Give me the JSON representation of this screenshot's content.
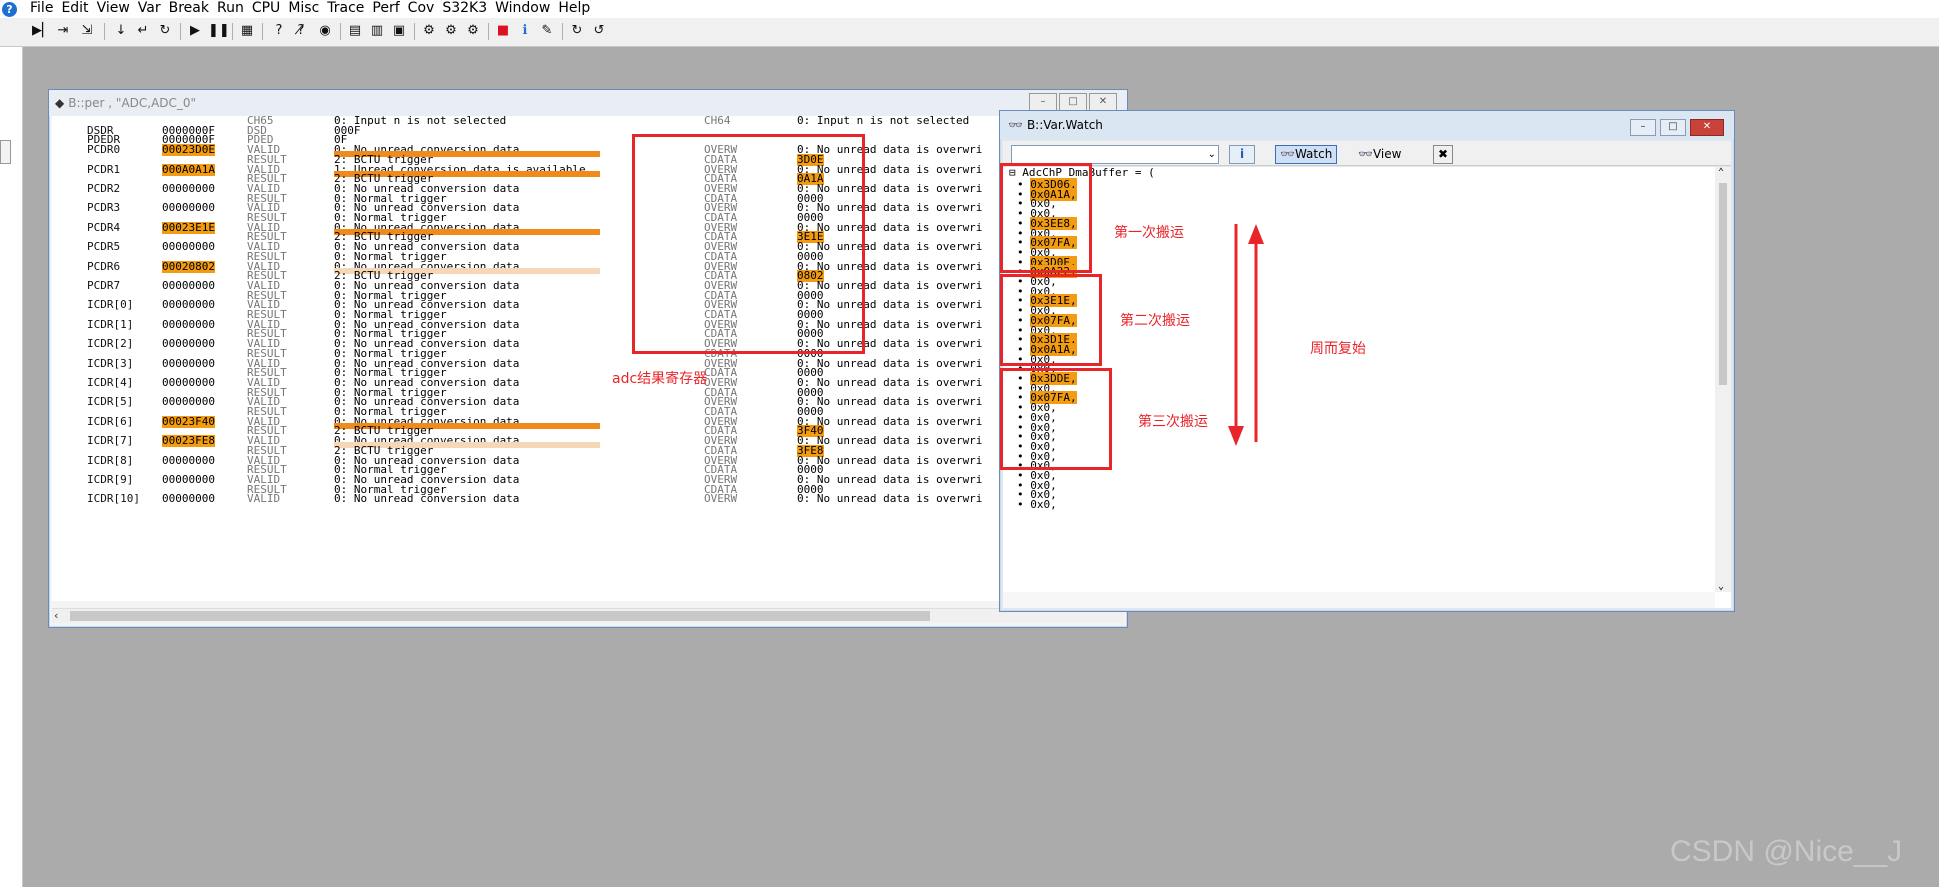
{
  "menubar": {
    "items": [
      "File",
      "Edit",
      "View",
      "Var",
      "Break",
      "Run",
      "CPU",
      "Misc",
      "Trace",
      "Perf",
      "Cov",
      "S32K3",
      "Window",
      "Help"
    ]
  },
  "per_window": {
    "title": "B::per , \"ADC,ADC_0\"",
    "rows": [
      {
        "c1": "",
        "c2": "",
        "c3": "CH65",
        "c4": "0: Input n is not selected",
        "c5": "CH64",
        "c6": "0: Input n is not selected"
      },
      {
        "c1": "DSDR",
        "c2": "0000000F",
        "c3": "DSD",
        "c4": "000F",
        "c5": "",
        "c6": ""
      },
      {
        "c1": "PDEDR",
        "c2": "0000000F",
        "c3": "PDED",
        "c4": "0F",
        "c5": "",
        "c6": ""
      },
      {
        "c1": "PCDR0",
        "c2": "00023D0E",
        "c3": "VALID",
        "c4": "0: No unread conversion data",
        "c5": "OVERW",
        "c6": "0: No unread data is overwri"
      },
      {
        "c1": "",
        "c2": "",
        "c3": "RESULT",
        "c4": "2: BCTU trigger",
        "c5": "CDATA",
        "c6": "3D0E"
      },
      {
        "c1": "PCDR1",
        "c2": "000A0A1A",
        "c3": "VALID",
        "c4": "1: Unread conversion data is available",
        "c5": "OVERW",
        "c6": "0: No unread data is overwri"
      },
      {
        "c1": "",
        "c2": "",
        "c3": "RESULT",
        "c4": "2: BCTU trigger",
        "c5": "CDATA",
        "c6": "0A1A"
      },
      {
        "c1": "PCDR2",
        "c2": "00000000",
        "c3": "VALID",
        "c4": "0: No unread conversion data",
        "c5": "OVERW",
        "c6": "0: No unread data is overwri"
      },
      {
        "c1": "",
        "c2": "",
        "c3": "RESULT",
        "c4": "0: Normal trigger",
        "c5": "CDATA",
        "c6": "0000"
      },
      {
        "c1": "PCDR3",
        "c2": "00000000",
        "c3": "VALID",
        "c4": "0: No unread conversion data",
        "c5": "OVERW",
        "c6": "0: No unread data is overwri"
      },
      {
        "c1": "",
        "c2": "",
        "c3": "RESULT",
        "c4": "0: Normal trigger",
        "c5": "CDATA",
        "c6": "0000"
      },
      {
        "c1": "PCDR4",
        "c2": "00023E1E",
        "c3": "VALID",
        "c4": "0: No unread conversion data",
        "c5": "OVERW",
        "c6": "0: No unread data is overwri"
      },
      {
        "c1": "",
        "c2": "",
        "c3": "RESULT",
        "c4": "2: BCTU trigger",
        "c5": "CDATA",
        "c6": "3E1E"
      },
      {
        "c1": "PCDR5",
        "c2": "00000000",
        "c3": "VALID",
        "c4": "0: No unread conversion data",
        "c5": "OVERW",
        "c6": "0: No unread data is overwri"
      },
      {
        "c1": "",
        "c2": "",
        "c3": "RESULT",
        "c4": "0: Normal trigger",
        "c5": "CDATA",
        "c6": "0000"
      },
      {
        "c1": "PCDR6",
        "c2": "00020802",
        "c3": "VALID",
        "c4": "0: No unread conversion data",
        "c5": "OVERW",
        "c6": "0: No unread data is overwri"
      },
      {
        "c1": "",
        "c2": "",
        "c3": "RESULT",
        "c4": "2: BCTU trigger",
        "c5": "CDATA",
        "c6": "0802"
      },
      {
        "c1": "PCDR7",
        "c2": "00000000",
        "c3": "VALID",
        "c4": "0: No unread conversion data",
        "c5": "OVERW",
        "c6": "0: No unread data is overwri"
      },
      {
        "c1": "",
        "c2": "",
        "c3": "RESULT",
        "c4": "0: Normal trigger",
        "c5": "CDATA",
        "c6": "0000"
      },
      {
        "c1": "ICDR[0]",
        "c2": "00000000",
        "c3": "VALID",
        "c4": "0: No unread conversion data",
        "c5": "OVERW",
        "c6": "0: No unread data is overwri"
      },
      {
        "c1": "",
        "c2": "",
        "c3": "RESULT",
        "c4": "0: Normal trigger",
        "c5": "CDATA",
        "c6": "0000"
      },
      {
        "c1": "ICDR[1]",
        "c2": "00000000",
        "c3": "VALID",
        "c4": "0: No unread conversion data",
        "c5": "OVERW",
        "c6": "0: No unread data is overwri"
      },
      {
        "c1": "",
        "c2": "",
        "c3": "RESULT",
        "c4": "0: Normal trigger",
        "c5": "CDATA",
        "c6": "0000"
      },
      {
        "c1": "ICDR[2]",
        "c2": "00000000",
        "c3": "VALID",
        "c4": "0: No unread conversion data",
        "c5": "OVERW",
        "c6": "0: No unread data is overwri"
      },
      {
        "c1": "",
        "c2": "",
        "c3": "RESULT",
        "c4": "0: Normal trigger",
        "c5": "CDATA",
        "c6": "0000"
      },
      {
        "c1": "ICDR[3]",
        "c2": "00000000",
        "c3": "VALID",
        "c4": "0: No unread conversion data",
        "c5": "OVERW",
        "c6": "0: No unread data is overwri"
      },
      {
        "c1": "",
        "c2": "",
        "c3": "RESULT",
        "c4": "0: Normal trigger",
        "c5": "CDATA",
        "c6": "0000"
      },
      {
        "c1": "ICDR[4]",
        "c2": "00000000",
        "c3": "VALID",
        "c4": "0: No unread conversion data",
        "c5": "OVERW",
        "c6": "0: No unread data is overwri"
      },
      {
        "c1": "",
        "c2": "",
        "c3": "RESULT",
        "c4": "0: Normal trigger",
        "c5": "CDATA",
        "c6": "0000"
      },
      {
        "c1": "ICDR[5]",
        "c2": "00000000",
        "c3": "VALID",
        "c4": "0: No unread conversion data",
        "c5": "OVERW",
        "c6": "0: No unread data is overwri"
      },
      {
        "c1": "",
        "c2": "",
        "c3": "RESULT",
        "c4": "0: Normal trigger",
        "c5": "CDATA",
        "c6": "0000"
      },
      {
        "c1": "ICDR[6]",
        "c2": "00023F40",
        "c3": "VALID",
        "c4": "0: No unread conversion data",
        "c5": "OVERW",
        "c6": "0: No unread data is overwri"
      },
      {
        "c1": "",
        "c2": "",
        "c3": "RESULT",
        "c4": "2: BCTU trigger",
        "c5": "CDATA",
        "c6": "3F40"
      },
      {
        "c1": "ICDR[7]",
        "c2": "00023FE8",
        "c3": "VALID",
        "c4": "0: No unread conversion data",
        "c5": "OVERW",
        "c6": "0: No unread data is overwri"
      },
      {
        "c1": "",
        "c2": "",
        "c3": "RESULT",
        "c4": "2: BCTU trigger",
        "c5": "CDATA",
        "c6": "3FE8"
      },
      {
        "c1": "ICDR[8]",
        "c2": "00000000",
        "c3": "VALID",
        "c4": "0: No unread conversion data",
        "c5": "OVERW",
        "c6": "0: No unread data is overwri"
      },
      {
        "c1": "",
        "c2": "",
        "c3": "RESULT",
        "c4": "0: Normal trigger",
        "c5": "CDATA",
        "c6": "0000"
      },
      {
        "c1": "ICDR[9]",
        "c2": "00000000",
        "c3": "VALID",
        "c4": "0: No unread conversion data",
        "c5": "OVERW",
        "c6": "0: No unread data is overwri"
      },
      {
        "c1": "",
        "c2": "",
        "c3": "RESULT",
        "c4": "0: Normal trigger",
        "c5": "CDATA",
        "c6": "0000"
      },
      {
        "c1": "ICDR[10]",
        "c2": "00000000",
        "c3": "VALID",
        "c4": "0: No unread conversion data",
        "c5": "OVERW",
        "c6": "0: No unread data is overwri"
      }
    ]
  },
  "watch_window": {
    "title": "B::Var.Watch",
    "watch_label": "Watch",
    "view_label": "View",
    "header": "AdcChP_DmaBuffer = (",
    "values": [
      "0x3D06,",
      "0x0A1A,",
      "0x0,",
      "0x0,",
      "0x3EE8,",
      "0x0,",
      "0x07FA,",
      "0x0,",
      "0x3D0E,",
      "0x0A22,",
      "0x0,",
      "0x0,",
      "0x3E1E,",
      "0x0,",
      "0x07FA,",
      "0x0,",
      "0x3D1E,",
      "0x0A1A,",
      "0x0,",
      "0x0,",
      "0x3DDE,",
      "0x0,",
      "0x07FA,",
      "0x0,",
      "0x0,",
      "0x0,",
      "0x0,",
      "0x0,",
      "0x0,",
      "0x0,",
      "0x0,",
      "0x0,",
      "0x0,",
      "0x0,"
    ]
  },
  "annotations": {
    "adc_result": "adc结果寄存器",
    "first": "第一次搬运",
    "second": "第二次搬运",
    "third": "第三次搬运",
    "cycle": "周而复始",
    "color": "#e8262a"
  },
  "watermark": "CSDN @Nice__J"
}
